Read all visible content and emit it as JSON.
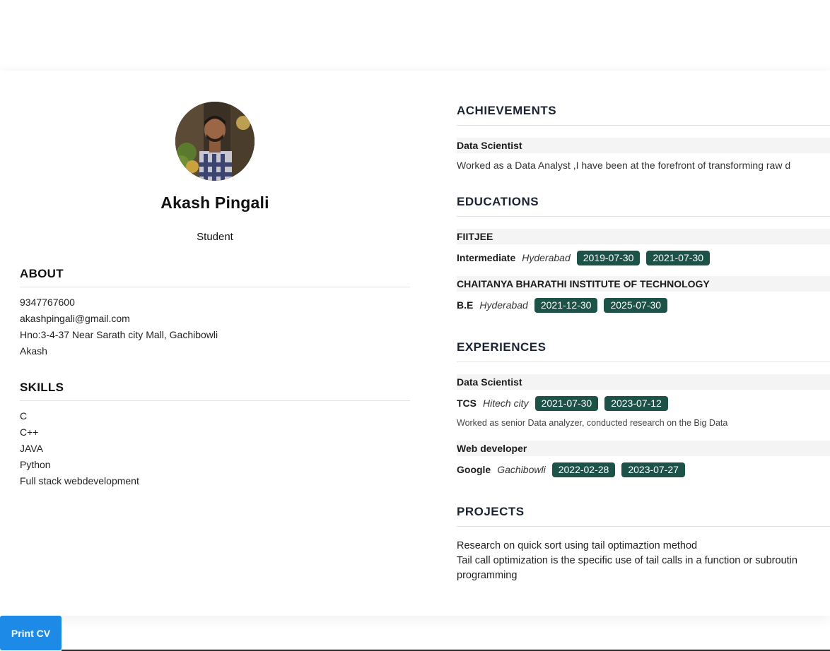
{
  "profile": {
    "name": "Akash Pingali",
    "role": "Student"
  },
  "about": {
    "heading": "ABOUT",
    "items": [
      "9347767600",
      "akashpingali@gmail.com",
      "Hno:3-4-37 Near Sarath city Mall, Gachibowli",
      "Akash"
    ]
  },
  "skills": {
    "heading": "SKILLS",
    "items": [
      "C",
      "C++",
      "JAVA",
      "Python",
      "Full stack webdevelopment"
    ]
  },
  "achievements": {
    "heading": "ACHIEVEMENTS",
    "items": [
      {
        "title": "Data Scientist",
        "description": "Worked as a Data Analyst ,I have been at the forefront of transforming raw d"
      }
    ]
  },
  "educations": {
    "heading": "EDUCATIONS",
    "items": [
      {
        "institution": "FIITJEE",
        "degree": "Intermediate",
        "location": "Hyderabad",
        "start": "2019-07-30",
        "end": "2021-07-30"
      },
      {
        "institution": "CHAITANYA BHARATHI INSTITUTE OF TECHNOLOGY",
        "degree": "B.E",
        "location": "Hyderabad",
        "start": "2021-12-30",
        "end": "2025-07-30"
      }
    ]
  },
  "experiences": {
    "heading": "EXPERIENCES",
    "items": [
      {
        "title": "Data Scientist",
        "company": "TCS",
        "location": "Hitech city",
        "start": "2021-07-30",
        "end": "2023-07-12",
        "description": "Worked as senior Data analyzer, conducted research on the Big Data"
      },
      {
        "title": "Web developer",
        "company": "Google",
        "location": "Gachibowli",
        "start": "2022-02-28",
        "end": "2023-07-27",
        "description": ""
      }
    ]
  },
  "projects": {
    "heading": "PROJECTS",
    "title": "Research on quick sort using tail optimaztion method",
    "description_line1": "Tail call optimization is the specific use of tail calls in a function or subroutin",
    "description_line2": "programming"
  },
  "actions": {
    "print_label": "Print CV"
  },
  "colors": {
    "badge": "#1d5248",
    "print_button": "#1c8ae6",
    "corner_marker": "#1f6fd1"
  }
}
